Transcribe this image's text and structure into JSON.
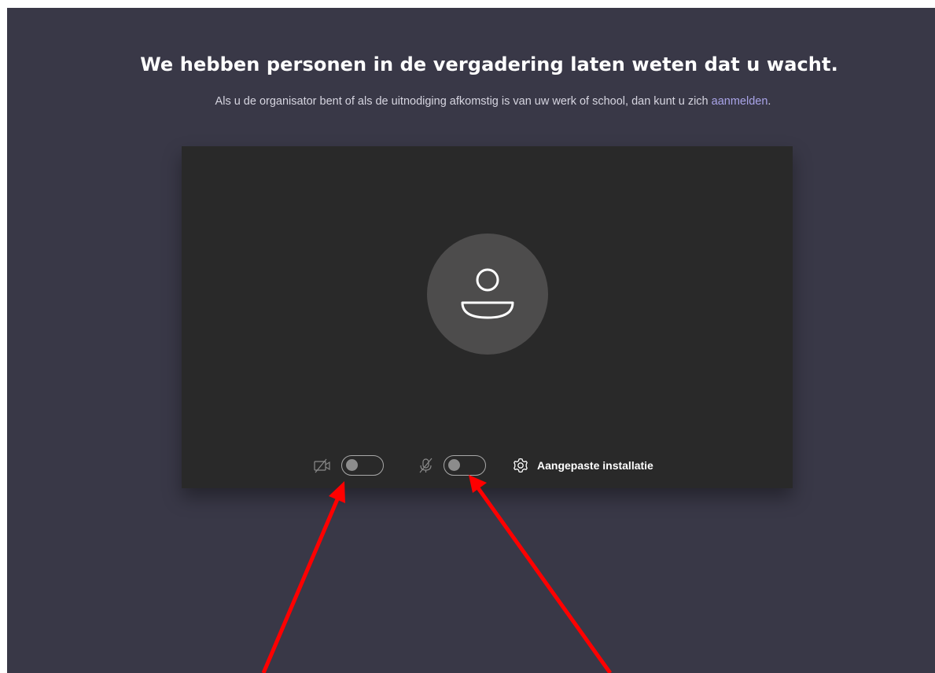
{
  "header": {
    "title": "We hebben personen in de vergadering laten weten dat u wacht.",
    "subtitle_prefix": "Als u de organisator bent of als de uitnodiging afkomstig is van uw werk of school, dan kunt u zich ",
    "sign_in_link": "aanmelden",
    "subtitle_suffix": "."
  },
  "controls": {
    "video_toggle": {
      "icon": "camera-off-icon",
      "state": "off"
    },
    "mic_toggle": {
      "icon": "mic-off-icon",
      "state": "off"
    },
    "device_settings": {
      "icon": "gear-icon",
      "label": "Aangepaste installatie"
    }
  },
  "colors": {
    "background": "#393847",
    "preview": "#292929",
    "avatar": "#4d4c4c",
    "link": "#a9a4e8",
    "annotation_arrow": "#ff0000"
  }
}
